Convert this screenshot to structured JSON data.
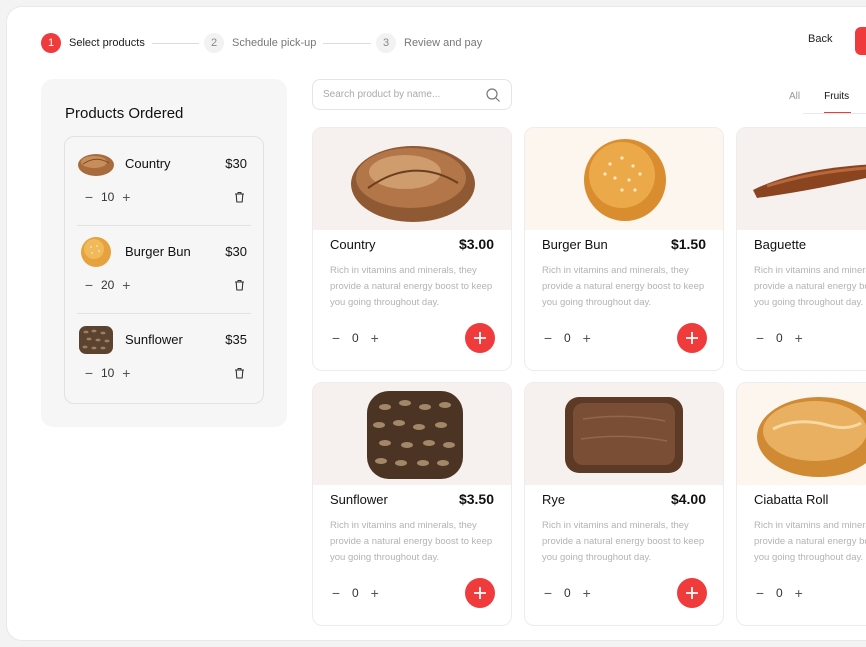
{
  "stepper": {
    "steps": [
      {
        "number": "1",
        "label": "Select products"
      },
      {
        "number": "2",
        "label": "Schedule pick-up"
      },
      {
        "number": "3",
        "label": "Review and pay"
      }
    ],
    "back_label": "Back"
  },
  "sidebar": {
    "title": "Products Ordered",
    "items": [
      {
        "name": "Country",
        "price": "$30",
        "quantity": "10",
        "icon": "country-bread"
      },
      {
        "name": "Burger Bun",
        "price": "$30",
        "quantity": "20",
        "icon": "burger-bun"
      },
      {
        "name": "Sunflower",
        "price": "$35",
        "quantity": "10",
        "icon": "sunflower-bread"
      }
    ]
  },
  "search": {
    "placeholder": "Search product by name..."
  },
  "filters": {
    "all": "All",
    "fruits": "Fruits",
    "active": "Fruits"
  },
  "products": [
    {
      "name": "Country",
      "price": "$3.00",
      "description": "Rich in vitamins and minerals, they provide a natural energy boost to keep you going throughout day.",
      "quantity": "0",
      "icon": "country-bread"
    },
    {
      "name": "Burger Bun",
      "price": "$1.50",
      "description": "Rich in vitamins and minerals, they provide a natural energy boost to keep you going throughout day.",
      "quantity": "0",
      "icon": "burger-bun"
    },
    {
      "name": "Baguette",
      "price": "",
      "description": "Rich in vitamins and minerals, they provide a natural energy boost to keep you going throughout day.",
      "quantity": "0",
      "icon": "baguette"
    },
    {
      "name": "Sunflower",
      "price": "$3.50",
      "description": "Rich in vitamins and minerals, they provide a natural energy boost to keep you going throughout day.",
      "quantity": "0",
      "icon": "sunflower-bread"
    },
    {
      "name": "Rye",
      "price": "$4.00",
      "description": "Rich in vitamins and minerals, they provide a natural energy boost to keep you going throughout day.",
      "quantity": "0",
      "icon": "rye-bread"
    },
    {
      "name": "Ciabatta Roll",
      "price": "",
      "description": "Rich in vitamins and minerals, they provide a natural energy boost to keep you going throughout day.",
      "quantity": "0",
      "icon": "ciabatta-roll"
    }
  ],
  "colors": {
    "accent": "#ef3b3b",
    "panel": "#f6f6f6",
    "muted_text": "#b3b3b3"
  }
}
